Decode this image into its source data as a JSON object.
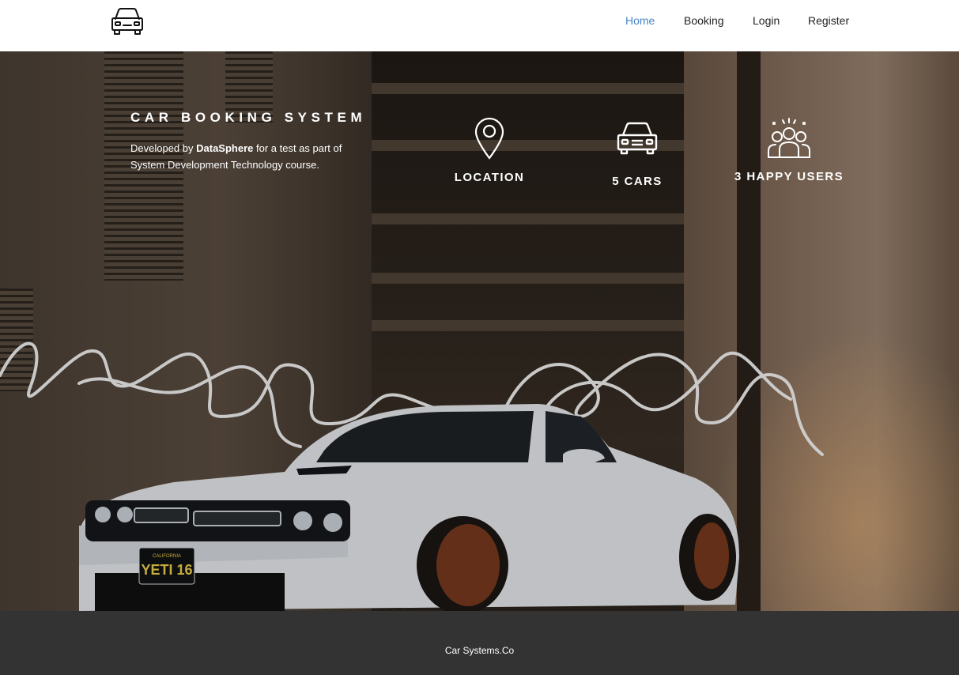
{
  "navbar": {
    "logo_icon": "car-outline-icon",
    "links": [
      {
        "label": "Home",
        "active": true
      },
      {
        "label": "Booking",
        "active": false
      },
      {
        "label": "Login",
        "active": false
      },
      {
        "label": "Register",
        "active": false
      }
    ],
    "active_color": "#4a86c5"
  },
  "hero": {
    "title": "CAR BOOKING SYSTEM",
    "desc_prefix": "Developed by ",
    "desc_brand": "DataSphere",
    "desc_suffix": " for a test as part of System Development Technology course.",
    "stats": [
      {
        "icon": "location-pin-icon",
        "label": "LOCATION"
      },
      {
        "icon": "car-front-icon",
        "label": "5 CARS"
      },
      {
        "icon": "happy-users-icon",
        "label": "3 HAPPY USERS"
      }
    ],
    "license_plate": "YETI 16",
    "plate_state": "CALIFORNIA"
  },
  "footer": {
    "text": "Car Systems.Co"
  }
}
